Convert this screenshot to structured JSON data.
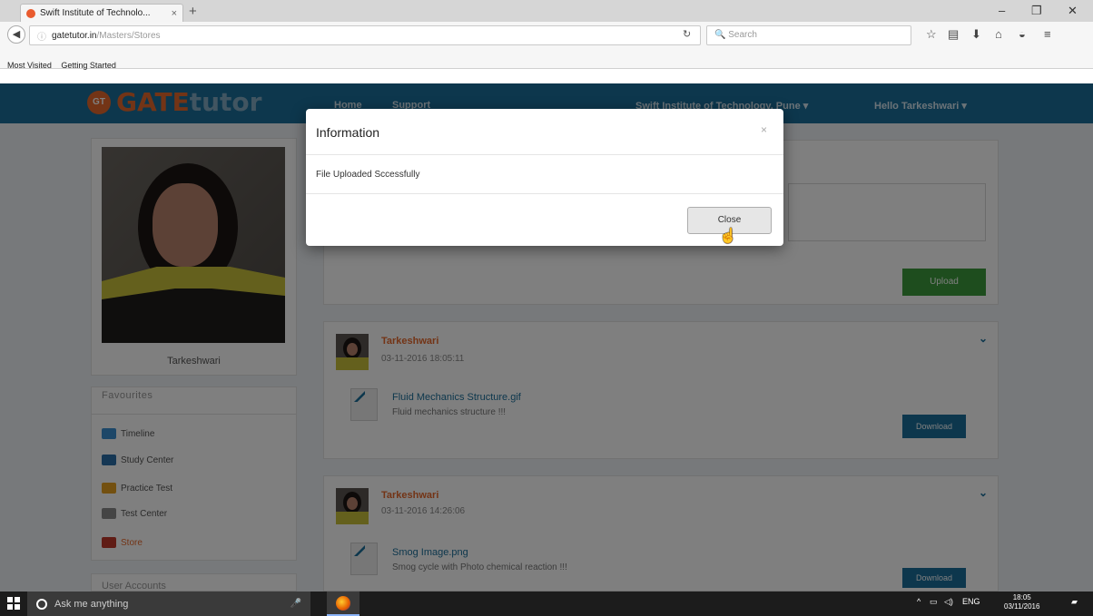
{
  "browser": {
    "tab_title": "Swift Institute of Technolo...",
    "tab_close": "×",
    "new_tab": "+",
    "url_host": "gatetutor.in",
    "url_path": "/Masters/Stores",
    "search_placeholder": "Search",
    "bookmarks": [
      "Most Visited",
      "Getting Started"
    ]
  },
  "site": {
    "logo_badge": "GT",
    "logo_gate": "GATE",
    "logo_tutor": "tutor",
    "nav": [
      "Home",
      "Support"
    ],
    "institute": "Swift Institute of Technology, Pune ▾",
    "greeting": "Hello Tarkeshwari ▾"
  },
  "profile": {
    "name": "Tarkeshwari"
  },
  "favourites": {
    "heading": "Favourites",
    "items": [
      {
        "label": "Timeline",
        "color": "#3a8fd0"
      },
      {
        "label": "Study Center",
        "color": "#2b6fa8"
      },
      {
        "label": "Practice Test",
        "color": "#e6a020"
      },
      {
        "label": "Test Center",
        "color": "#8a8a8a"
      },
      {
        "label": "Store",
        "color": "#c0392b"
      }
    ]
  },
  "user_accounts": {
    "heading": "User Accounts"
  },
  "upload": {
    "button": "Upload"
  },
  "posts": [
    {
      "author": "Tarkeshwari",
      "time": "03-11-2016 18:05:11",
      "file_name": "Fluid Mechanics Structure.gif",
      "file_desc": "Fluid mechanics structure !!!",
      "download": "Download"
    },
    {
      "author": "Tarkeshwari",
      "time": "03-11-2016 14:26:06",
      "file_name": "Smog Image.png",
      "file_desc": "Smog cycle with Photo chemical reaction !!!",
      "download": "Download"
    }
  ],
  "modal": {
    "title": "Information",
    "close_x": "×",
    "message": "File Uploaded Sccessfully",
    "close_button": "Close"
  },
  "taskbar": {
    "search_placeholder": "Ask me anything",
    "language": "ENG",
    "time": "18:05",
    "date": "03/11/2016"
  }
}
